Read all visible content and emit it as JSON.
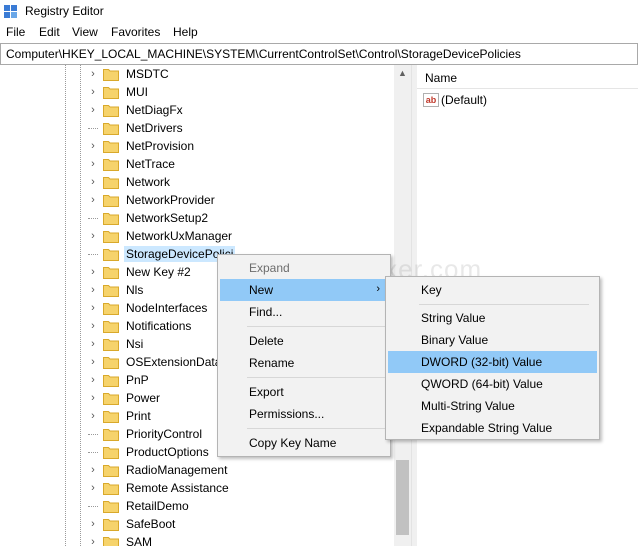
{
  "window": {
    "title": "Registry Editor"
  },
  "menubar": {
    "items": [
      "File",
      "Edit",
      "View",
      "Favorites",
      "Help"
    ]
  },
  "address": {
    "path": "Computer\\HKEY_LOCAL_MACHINE\\SYSTEM\\CurrentControlSet\\Control\\StorageDevicePolicies"
  },
  "tree": {
    "items": [
      {
        "label": "MSDTC",
        "expandable": true
      },
      {
        "label": "MUI",
        "expandable": true
      },
      {
        "label": "NetDiagFx",
        "expandable": true
      },
      {
        "label": "NetDrivers",
        "expandable": false
      },
      {
        "label": "NetProvision",
        "expandable": true
      },
      {
        "label": "NetTrace",
        "expandable": true
      },
      {
        "label": "Network",
        "expandable": true
      },
      {
        "label": "NetworkProvider",
        "expandable": true
      },
      {
        "label": "NetworkSetup2",
        "expandable": false
      },
      {
        "label": "NetworkUxManager",
        "expandable": true
      },
      {
        "label": "StorageDevicePolici",
        "expandable": false,
        "selected": true
      },
      {
        "label": "New Key #2",
        "expandable": true
      },
      {
        "label": "Nls",
        "expandable": true
      },
      {
        "label": "NodeInterfaces",
        "expandable": true
      },
      {
        "label": "Notifications",
        "expandable": true
      },
      {
        "label": "Nsi",
        "expandable": true
      },
      {
        "label": "OSExtensionDatab",
        "expandable": true
      },
      {
        "label": "PnP",
        "expandable": true
      },
      {
        "label": "Power",
        "expandable": true
      },
      {
        "label": "Print",
        "expandable": true
      },
      {
        "label": "PriorityControl",
        "expandable": false
      },
      {
        "label": "ProductOptions",
        "expandable": false
      },
      {
        "label": "RadioManagement",
        "expandable": true
      },
      {
        "label": "Remote Assistance",
        "expandable": true
      },
      {
        "label": "RetailDemo",
        "expandable": false
      },
      {
        "label": "SafeBoot",
        "expandable": true
      },
      {
        "label": "SAM",
        "expandable": true
      }
    ]
  },
  "values": {
    "column_name": "Name",
    "rows": [
      {
        "name": "(Default)",
        "icon": "string-value-icon"
      }
    ]
  },
  "context_menu": {
    "expand": "Expand",
    "new": "New",
    "find": "Find...",
    "delete": "Delete",
    "rename": "Rename",
    "export": "Export",
    "permissions": "Permissions...",
    "copy_key_name": "Copy Key Name",
    "submenu_arrow": "›"
  },
  "new_submenu": {
    "key": "Key",
    "string_value": "String Value",
    "binary_value": "Binary Value",
    "dword_value": "DWORD (32-bit) Value",
    "qword_value": "QWORD (64-bit) Value",
    "multi_string_value": "Multi-String Value",
    "expandable_string_value": "Expandable String Value"
  },
  "watermark": {
    "text": "WindowsFixer.com"
  },
  "colors": {
    "selection": "#cce8ff",
    "menu_highlight": "#91c9f7",
    "folder": "#f6d36b",
    "menu_bg": "#f2f2f2"
  }
}
